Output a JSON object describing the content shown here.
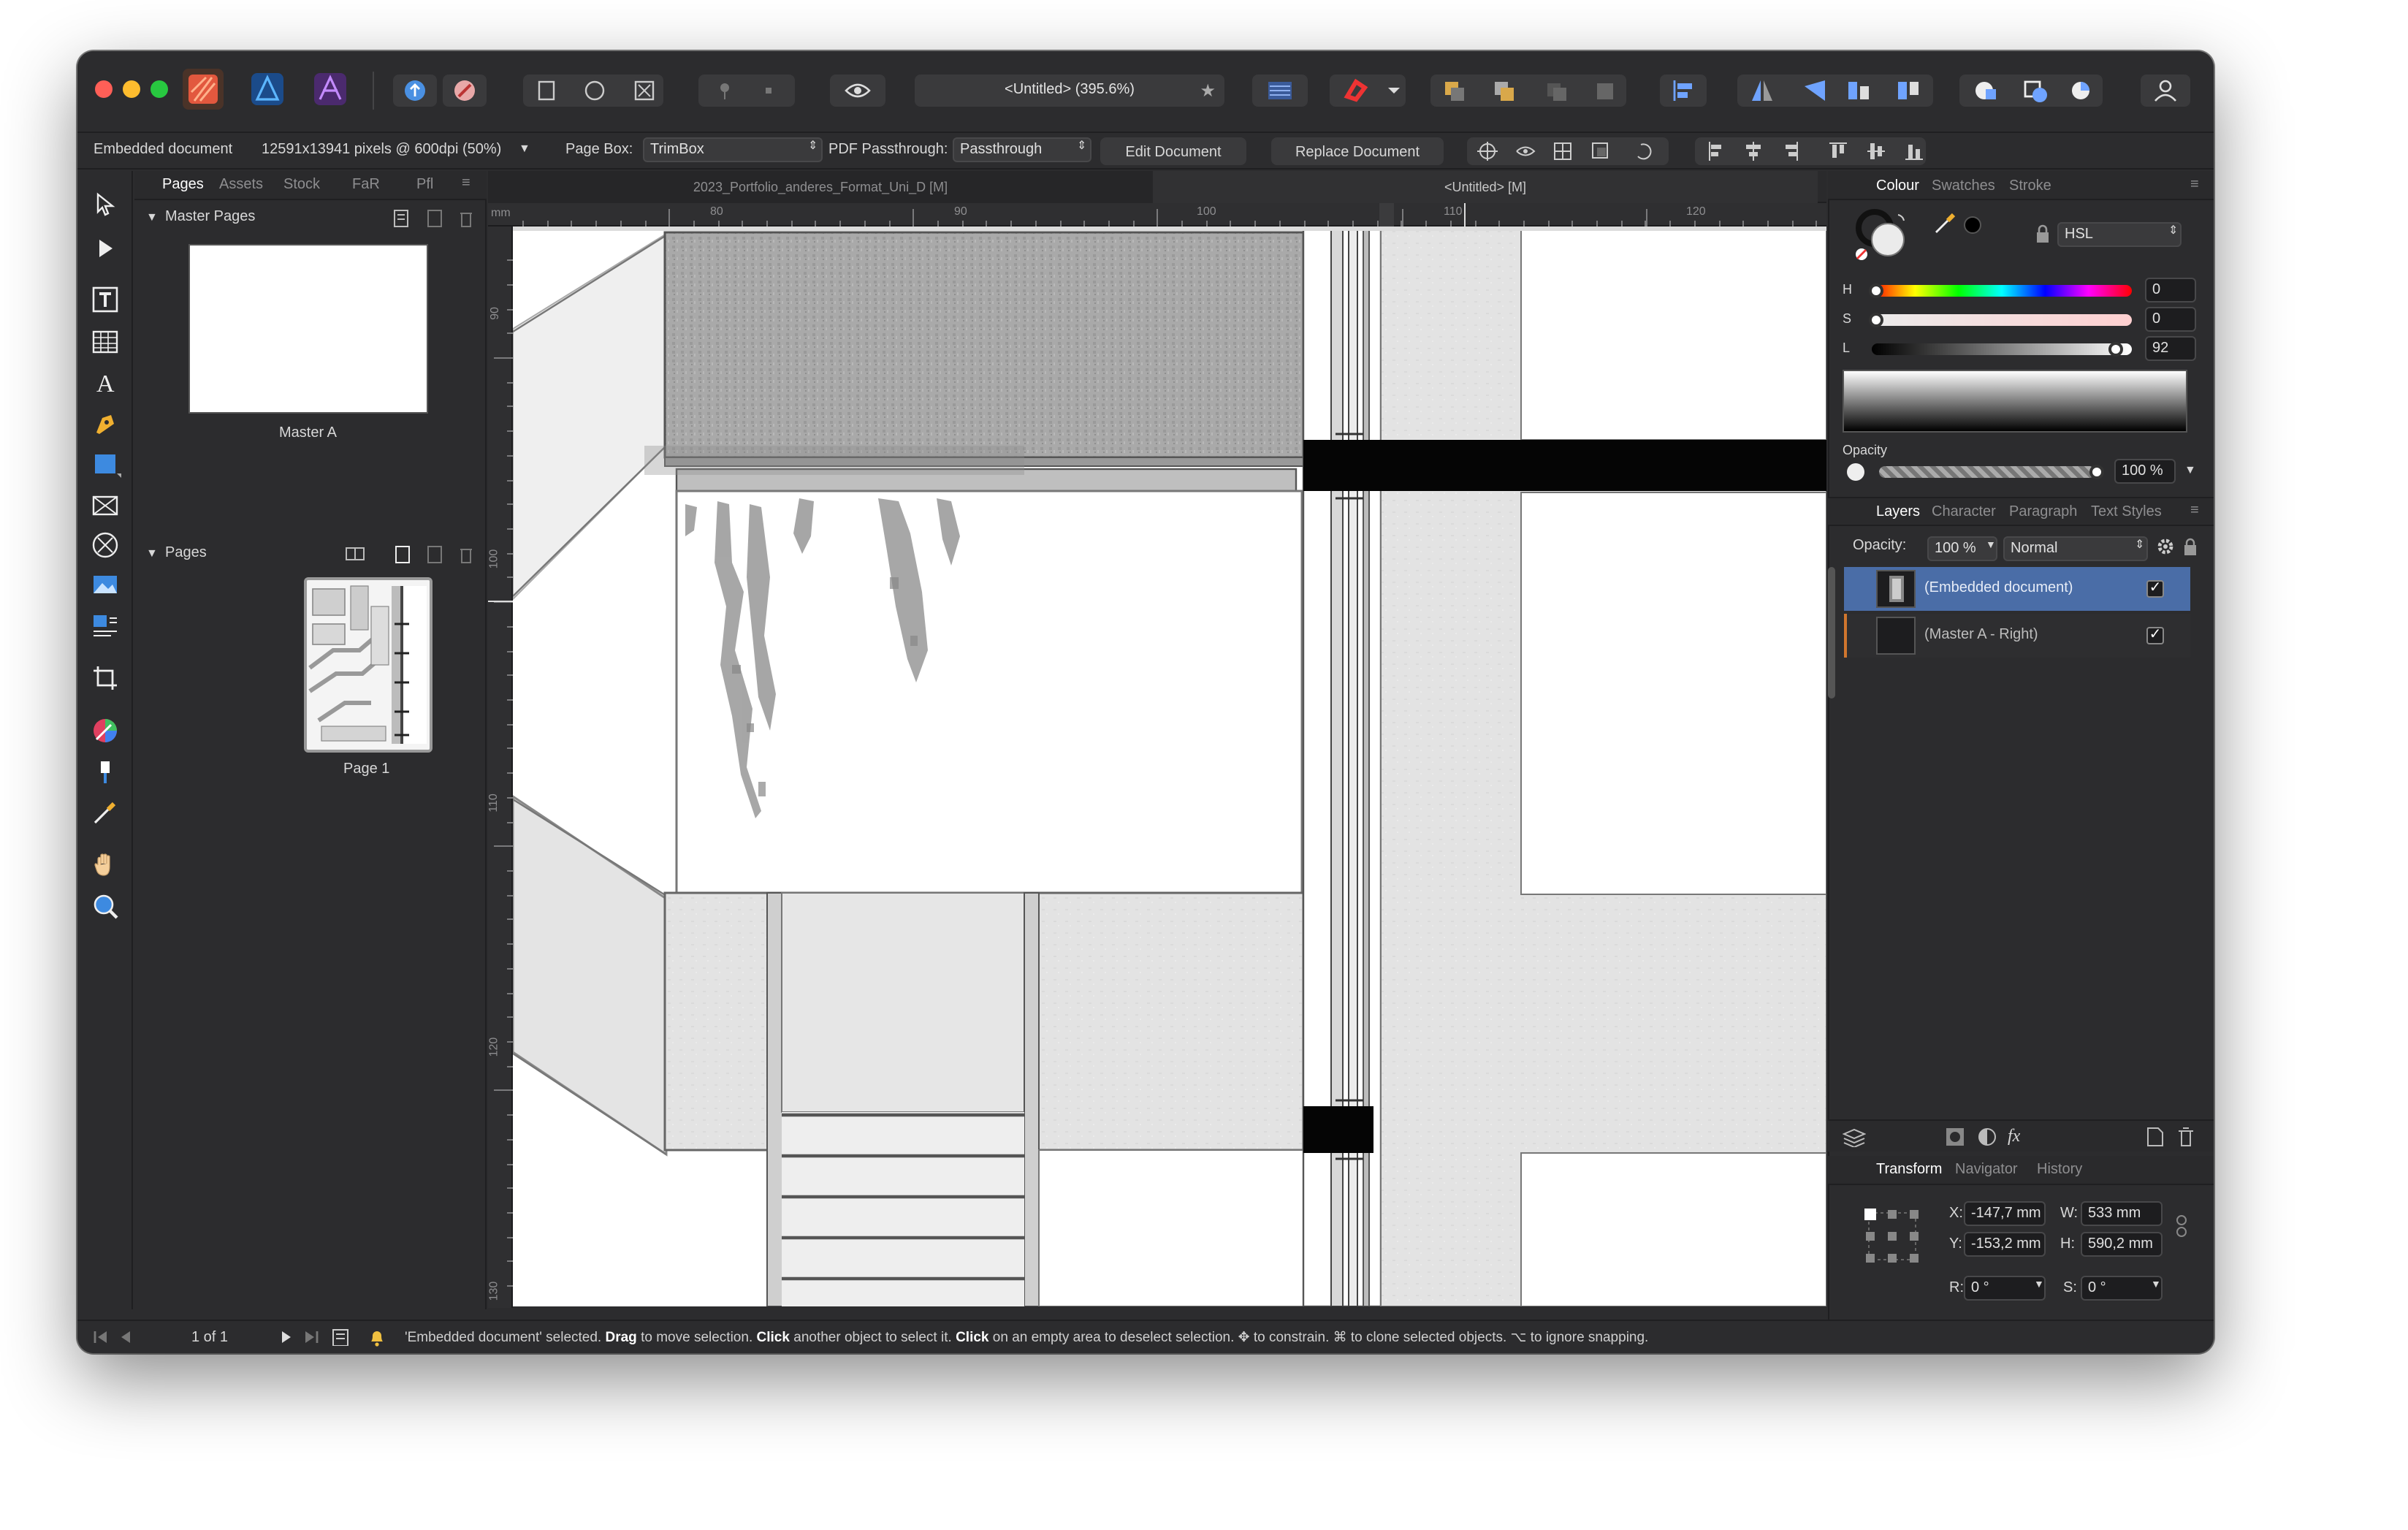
{
  "toolbar": {
    "document_title": "<Untitled> (395.6%)",
    "icons": [
      "publisher-persona-icon",
      "designer-persona-icon",
      "photo-persona-icon",
      "share-icon",
      "macro-icon",
      "preflight-icon",
      "view-mode-icon",
      "clip-icon",
      "pin-icon",
      "snap-icon",
      "preview-icon",
      "snapping-magnet-icon",
      "arrange-icon",
      "align-icon",
      "flip-icon",
      "boolean-icon",
      "account-icon"
    ]
  },
  "context": {
    "object_type": "Embedded document",
    "dimensions": "12591x13941 pixels @ 600dpi (50%)",
    "page_box_label": "Page Box:",
    "page_box_value": "TrimBox",
    "pdf_label": "PDF Passthrough:",
    "pdf_value": "Passthrough",
    "edit_button": "Edit Document",
    "replace_button": "Replace Document"
  },
  "left_panel": {
    "tabs": [
      "Pages",
      "Assets",
      "Stock",
      "FaR",
      "Pfl"
    ],
    "master_section": "Master Pages",
    "master_name": "Master A",
    "pages_section": "Pages",
    "page_name": "Page 1"
  },
  "doc_tabs": [
    "2023_Portfolio_anderes_Format_Uni_D [M]",
    "<Untitled> [M]"
  ],
  "ruler": {
    "unit": "mm",
    "h_ticks": [
      "80",
      "90",
      "100",
      "110",
      "120"
    ],
    "v_ticks": [
      "90",
      "100",
      "110",
      "120",
      "130"
    ]
  },
  "colour_panel": {
    "tabs": [
      "Colour",
      "Swatches",
      "Stroke"
    ],
    "model": "HSL",
    "h_label": "H",
    "h_value": "0",
    "s_label": "S",
    "s_value": "0",
    "l_label": "L",
    "l_value": "92",
    "opacity_label": "Opacity",
    "opacity_value": "100 %"
  },
  "layers_panel": {
    "tabs": [
      "Layers",
      "Character",
      "Paragraph",
      "Text Styles"
    ],
    "opacity_label": "Opacity:",
    "opacity_value": "100 %",
    "blend_mode": "Normal",
    "rows": [
      {
        "name": "(Embedded document)",
        "checked": "✓"
      },
      {
        "name": "(Master A - Right)",
        "checked": "✓"
      }
    ]
  },
  "transform_panel": {
    "tabs": [
      "Transform",
      "Navigator",
      "History"
    ],
    "x_label": "X:",
    "x_value": "-147,7 mm",
    "y_label": "Y:",
    "y_value": "-153,2 mm",
    "w_label": "W:",
    "w_value": "533 mm",
    "h_label": "H:",
    "h_value": "590,2 mm",
    "r_label": "R:",
    "r_value": "0 °",
    "s_label": "S:",
    "s_value": "0 °"
  },
  "status": {
    "page_counter": "1 of 1",
    "parts": [
      {
        "t": "'Embedded document' selected. ",
        "b": false
      },
      {
        "t": "Drag",
        "b": true
      },
      {
        "t": " to move selection. ",
        "b": false
      },
      {
        "t": "Click",
        "b": true
      },
      {
        "t": " another object to select it. ",
        "b": false
      },
      {
        "t": "Click",
        "b": true
      },
      {
        "t": " on an empty area to deselect selection. ✥ to constrain. ⌘ to clone selected objects. ⌥ to ignore snapping.",
        "b": false
      }
    ]
  },
  "colors": {
    "accent": "#4a6da7",
    "selection_row": "#4a6da7",
    "window_bg": "#2c2c2e"
  }
}
